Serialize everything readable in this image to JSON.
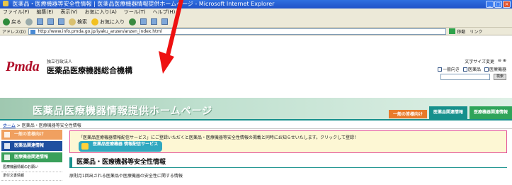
{
  "window": {
    "title": "医薬品・医療機器等安全性情報 | 医薬品医療機器情報提供ホームページ - Microsoft Internet Explorer",
    "controls": [
      "_",
      "□",
      "×"
    ]
  },
  "menu": [
    "ファイル(F)",
    "編集(E)",
    "表示(V)",
    "お気に入り(A)",
    "ツール(T)",
    "ヘルプ(H)"
  ],
  "toolbar": {
    "back": "戻る",
    "search": "検索",
    "favorites": "お気に入り"
  },
  "address": {
    "label": "アドレス(D)",
    "url": "http://www.info.pmda.go.jp/iyaku_anzen/anzen_index.html",
    "go": "移動",
    "links": "リンク"
  },
  "header": {
    "logo": "Pmda",
    "org_sub": "独立行政法人",
    "org_name": "医薬品医療機器総合機構",
    "font_size_label": "文字サイズ変更",
    "checks": [
      "一般向き",
      "医薬品",
      "医療機器"
    ],
    "search_btn": "検索"
  },
  "banner": {
    "title": "医薬品医療機器情報提供ホームページ",
    "tabs": [
      "一般の皆様向け",
      "医薬品関連情報",
      "医療機器関連情報"
    ]
  },
  "breadcrumb": {
    "home": "ホーム",
    "current": "医薬品・医療機器等安全性情報"
  },
  "sidebar": {
    "items": [
      "一般の皆様向け",
      "医薬品関連情報",
      "医療機器関連情報"
    ],
    "links": [
      "医療機器情報のお願い",
      "添付文書情報"
    ]
  },
  "notice": {
    "text": "「医薬品医療機器情報配信サービス」にご登録いただくと医薬品・医療機器等安全性情報の掲載と同時にお知らせいたします。クリックして登録！",
    "badge": "医薬品医療機器 情報配信サービス"
  },
  "main": {
    "title": "医薬品・医療機器等安全性情報",
    "description": "原則月1回出される医薬品や医療機器の安全性に関する情報"
  },
  "colors": {
    "annotation": "#ee1111",
    "banner_green": "#bfe0cf",
    "tab_teal": "#17908c"
  }
}
